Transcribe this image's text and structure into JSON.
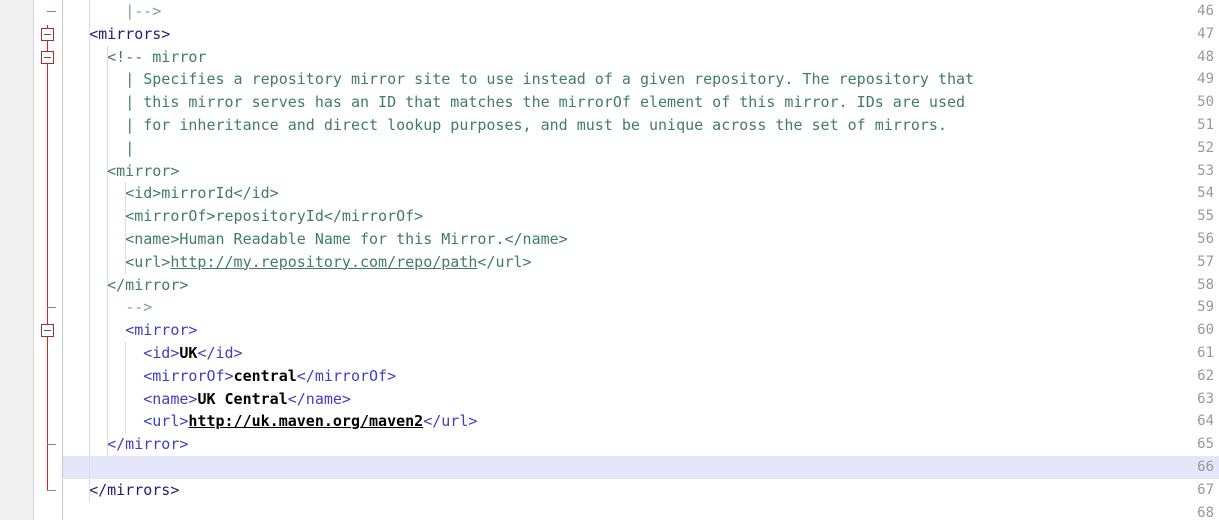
{
  "editor": {
    "type": "xml-code-editor",
    "file_kind": "maven-settings-xml",
    "current_line": 66,
    "colors": {
      "background": "#ffffff",
      "gutter_background": "#f1f1f1",
      "line_number": "#999999",
      "current_line_highlight": "#e6e6fa",
      "fold_rail": "#dd2222",
      "comment": "#3f7f5f",
      "tag": "#3f3fbf",
      "text_content": "#000000",
      "indent_guide": "#dcdcdc"
    },
    "gutter": {
      "first_line": 46,
      "last_line": 68,
      "line_numbers": [
        46,
        47,
        48,
        49,
        50,
        51,
        52,
        53,
        54,
        55,
        56,
        57,
        58,
        59,
        60,
        61,
        62,
        63,
        64,
        65,
        66,
        67,
        68
      ],
      "fold_boxes": [
        47,
        48,
        60
      ],
      "fold_ticks": [
        46,
        59,
        65,
        67
      ]
    },
    "lines": [
      {
        "number": 46,
        "indent": 3,
        "segments": [
          {
            "text": "|-->",
            "style": "comment-dim"
          }
        ]
      },
      {
        "number": 47,
        "indent": 1,
        "segments": [
          {
            "text": "<mirrors>",
            "style": "tag-dark"
          }
        ]
      },
      {
        "number": 48,
        "indent": 2,
        "segments": [
          {
            "text": "<!-- mirror",
            "style": "comment"
          }
        ]
      },
      {
        "number": 49,
        "indent": 3,
        "segments": [
          {
            "text": "| Specifies a repository mirror site to use instead of a given repository. The repository that",
            "style": "comment"
          }
        ]
      },
      {
        "number": 50,
        "indent": 3,
        "segments": [
          {
            "text": "| this mirror serves has an ID that matches the mirrorOf element of this mirror. IDs are used",
            "style": "comment"
          }
        ]
      },
      {
        "number": 51,
        "indent": 3,
        "segments": [
          {
            "text": "| for inheritance and direct lookup purposes, and must be unique across the set of mirrors.",
            "style": "comment"
          }
        ]
      },
      {
        "number": 52,
        "indent": 3,
        "segments": [
          {
            "text": "|",
            "style": "comment"
          }
        ]
      },
      {
        "number": 53,
        "indent": 2,
        "segments": [
          {
            "text": "<mirror>",
            "style": "comment"
          }
        ]
      },
      {
        "number": 54,
        "indent": 3,
        "segments": [
          {
            "text": "<id>mirrorId</id>",
            "style": "comment"
          }
        ]
      },
      {
        "number": 55,
        "indent": 3,
        "segments": [
          {
            "text": "<mirrorOf>repositoryId</mirrorOf>",
            "style": "comment"
          }
        ]
      },
      {
        "number": 56,
        "indent": 3,
        "segments": [
          {
            "text": "<name>Human Readable Name for this Mirror.</name>",
            "style": "comment"
          }
        ]
      },
      {
        "number": 57,
        "indent": 3,
        "segments": [
          {
            "text": "<url>",
            "style": "comment"
          },
          {
            "text": "http://my.repository.com/repo/path",
            "style": "link"
          },
          {
            "text": "</url>",
            "style": "comment"
          }
        ]
      },
      {
        "number": 58,
        "indent": 2,
        "segments": [
          {
            "text": "</mirror>",
            "style": "comment"
          }
        ]
      },
      {
        "number": 59,
        "indent": 3,
        "segments": [
          {
            "text": "-->",
            "style": "comment-dim"
          }
        ]
      },
      {
        "number": 60,
        "indent": 3,
        "segments": [
          {
            "text": "<mirror>",
            "style": "tag"
          }
        ]
      },
      {
        "number": 61,
        "indent": 4,
        "segments": [
          {
            "text": "<id>",
            "style": "tag"
          },
          {
            "text": "UK",
            "style": "text"
          },
          {
            "text": "</id>",
            "style": "tag"
          }
        ]
      },
      {
        "number": 62,
        "indent": 4,
        "segments": [
          {
            "text": "<mirrorOf>",
            "style": "tag"
          },
          {
            "text": "central",
            "style": "text"
          },
          {
            "text": "</mirrorOf>",
            "style": "tag"
          }
        ]
      },
      {
        "number": 63,
        "indent": 4,
        "segments": [
          {
            "text": "<name>",
            "style": "tag"
          },
          {
            "text": "UK Central",
            "style": "text"
          },
          {
            "text": "</name>",
            "style": "tag"
          }
        ]
      },
      {
        "number": 64,
        "indent": 4,
        "segments": [
          {
            "text": "<url>",
            "style": "tag"
          },
          {
            "text": "http://uk.maven.org/maven2",
            "style": "link-bold"
          },
          {
            "text": "</url>",
            "style": "tag"
          }
        ]
      },
      {
        "number": 65,
        "indent": 2,
        "segments": [
          {
            "text": "</mirror>",
            "style": "tag"
          }
        ]
      },
      {
        "number": 66,
        "indent": 0,
        "segments": []
      },
      {
        "number": 67,
        "indent": 1,
        "segments": [
          {
            "text": "</mirrors>",
            "style": "tag-dark"
          }
        ]
      },
      {
        "number": 68,
        "indent": 0,
        "segments": []
      }
    ]
  }
}
